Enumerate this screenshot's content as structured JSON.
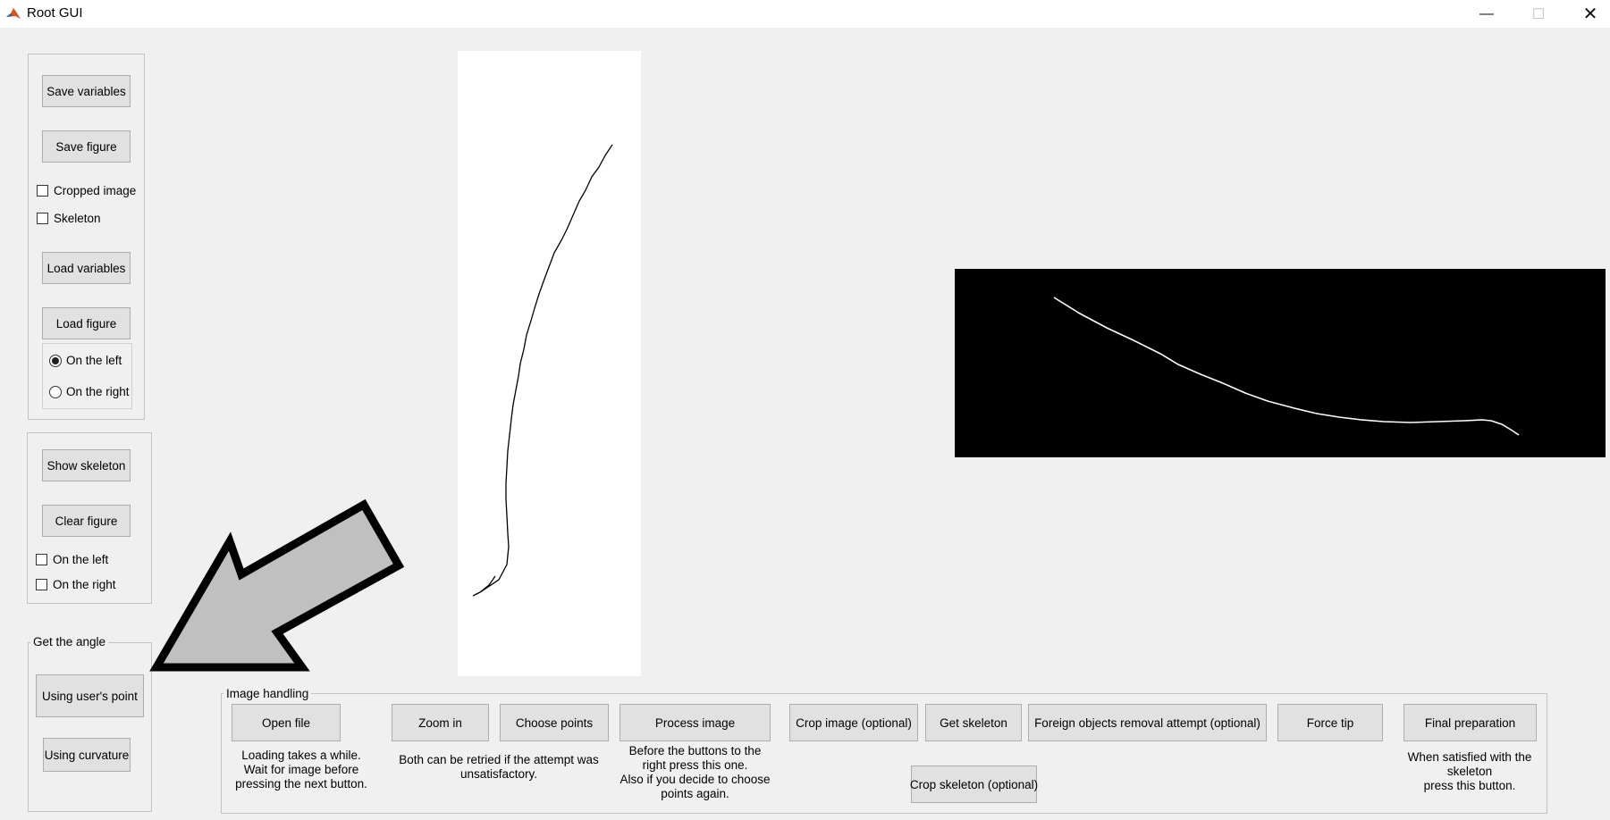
{
  "window": {
    "title": "Root GUI"
  },
  "save_panel": {
    "save_variables": "Save variables",
    "save_figure": "Save figure",
    "cropped_image": "Cropped image",
    "skeleton": "Skeleton",
    "load_variables": "Load variables",
    "load_figure": "Load figure",
    "on_left": "On the left",
    "on_right": "On the right",
    "selected_side": "On the left"
  },
  "show_panel": {
    "show_skeleton": "Show skeleton",
    "clear_figure": "Clear figure",
    "on_left": "On the left",
    "on_right": "On the right"
  },
  "angle_panel": {
    "title": "Get the angle",
    "users_point": "Using user's point",
    "curvature": "Using curvature"
  },
  "image_panel": {
    "title": "Image handling",
    "open_file": "Open file",
    "open_note": "Loading takes a while.\nWait for  image before\npressing the next button.",
    "zoom_in": "Zoom in",
    "choose_points": "Choose points",
    "retry_note": "Both can be retried if the attempt was\nunsatisfactory.",
    "process_image": "Process image",
    "process_note": "Before the buttons to the\nright press this one.\nAlso if you decide to choose\npoints again.",
    "crop_image": "Crop image (optional)",
    "get_skeleton": "Get skeleton",
    "foreign_removal": "Foreign objects removal attempt (optional)",
    "force_tip": "Force tip",
    "final_preparation": "Final preparation",
    "final_note": "When satisfied with the\nskeleton\npress this button.",
    "crop_skeleton": "Crop skeleton (optional)"
  },
  "colors": {
    "background": "#f0f0f0",
    "button": "#e1e1e1",
    "arrow_fill": "#c0c0c0"
  }
}
